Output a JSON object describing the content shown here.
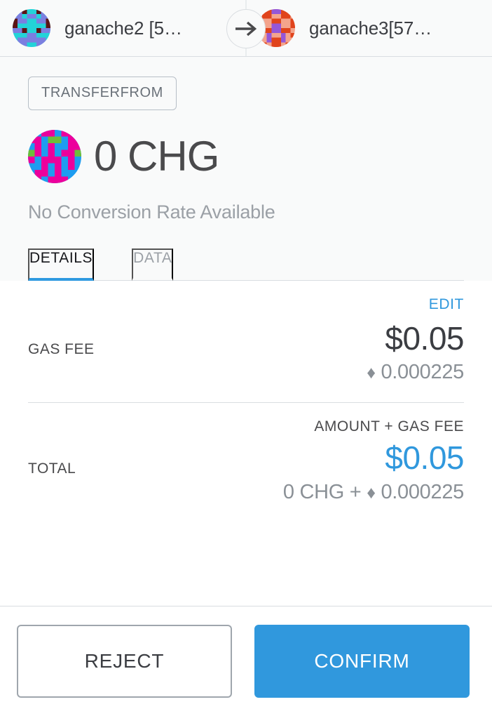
{
  "header": {
    "from_account": "ganache2 [5…",
    "to_account": "ganache3[57…",
    "arrow_icon": "arrow-right-icon",
    "from_identicon": {
      "name": "sender-identicon",
      "colors": [
        "#23d3d8",
        "#7b7fe0",
        "#5c1414"
      ]
    },
    "to_identicon": {
      "name": "recipient-identicon",
      "colors": [
        "#f4a48c",
        "#e0441c",
        "#9457d8"
      ]
    }
  },
  "summary": {
    "action_type": "TRANSFERFROM",
    "token_identicon": {
      "name": "token-identicon",
      "colors": [
        "#1e9cf0",
        "#ec009c",
        "#6cbe3a"
      ]
    },
    "amount": "0 CHG",
    "conversion_note": "No Conversion Rate Available"
  },
  "tabs": [
    {
      "label": "DETAILS",
      "active": true
    },
    {
      "label": "DATA",
      "active": false
    }
  ],
  "details": {
    "edit_label": "EDIT",
    "gas_fee": {
      "label": "GAS FEE",
      "fiat": "$0.05",
      "native_symbol": "♦",
      "native_amount": "0.000225"
    },
    "total": {
      "caption": "AMOUNT + GAS FEE",
      "label": "TOTAL",
      "fiat": "$0.05",
      "native_breakdown_prefix": "0 CHG +",
      "native_symbol": "♦",
      "native_amount": "0.000225"
    }
  },
  "footer": {
    "reject_label": "REJECT",
    "confirm_label": "CONFIRM"
  },
  "colors": {
    "accent_blue": "#3098dd",
    "text_dark": "#3b3d42",
    "text_muted": "#8a9096",
    "border": "#d9dde1",
    "panel_bg": "#f9fafa"
  }
}
